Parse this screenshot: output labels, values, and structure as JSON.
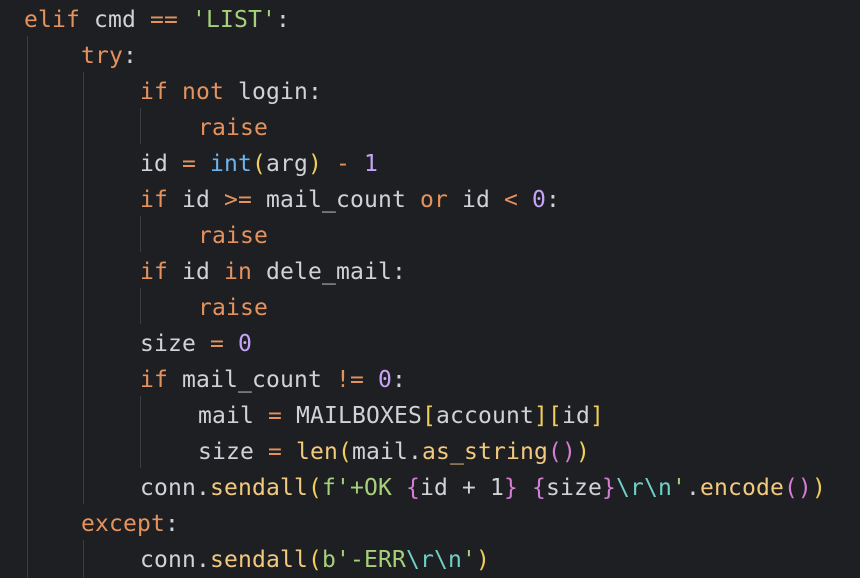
{
  "theme": {
    "background": "#1e1f22",
    "colors": {
      "keyword": "#e5925d",
      "string": "#a6d07a",
      "number": "#c6a3f7",
      "builtin": "#6cb4ee",
      "function": "#f2c97d",
      "plain": "#cfd2d6",
      "bracket": "#f0d05a",
      "escape": "#6fd0c6",
      "indent_guide": "#3a3d42"
    }
  },
  "code": {
    "lines": [
      [
        {
          "t": "elif",
          "c": "kw"
        },
        {
          "t": " cmd ",
          "c": "pl"
        },
        {
          "t": "==",
          "c": "op"
        },
        {
          "t": " ",
          "c": "pl"
        },
        {
          "t": "'LIST'",
          "c": "str"
        },
        {
          "t": ":",
          "c": "punc"
        }
      ],
      [
        {
          "t": "try",
          "c": "kw"
        },
        {
          "t": ":",
          "c": "punc"
        }
      ],
      [
        {
          "t": "if",
          "c": "kw"
        },
        {
          "t": " ",
          "c": "pl"
        },
        {
          "t": "not",
          "c": "kw"
        },
        {
          "t": " login:",
          "c": "pl"
        }
      ],
      [
        {
          "t": "raise",
          "c": "kw"
        }
      ],
      [
        {
          "t": "id ",
          "c": "pl"
        },
        {
          "t": "=",
          "c": "op"
        },
        {
          "t": " ",
          "c": "pl"
        },
        {
          "t": "int",
          "c": "bi"
        },
        {
          "t": "(",
          "c": "paren"
        },
        {
          "t": "arg",
          "c": "pl"
        },
        {
          "t": ")",
          "c": "paren"
        },
        {
          "t": " ",
          "c": "pl"
        },
        {
          "t": "-",
          "c": "op"
        },
        {
          "t": " ",
          "c": "pl"
        },
        {
          "t": "1",
          "c": "num"
        }
      ],
      [
        {
          "t": "if",
          "c": "kw"
        },
        {
          "t": " id ",
          "c": "pl"
        },
        {
          "t": ">=",
          "c": "op"
        },
        {
          "t": " mail_count ",
          "c": "pl"
        },
        {
          "t": "or",
          "c": "kw"
        },
        {
          "t": " id ",
          "c": "pl"
        },
        {
          "t": "<",
          "c": "op"
        },
        {
          "t": " ",
          "c": "pl"
        },
        {
          "t": "0",
          "c": "num"
        },
        {
          "t": ":",
          "c": "punc"
        }
      ],
      [
        {
          "t": "raise",
          "c": "kw"
        }
      ],
      [
        {
          "t": "if",
          "c": "kw"
        },
        {
          "t": " id ",
          "c": "pl"
        },
        {
          "t": "in",
          "c": "kw"
        },
        {
          "t": " dele_mail:",
          "c": "pl"
        }
      ],
      [
        {
          "t": "raise",
          "c": "kw"
        }
      ],
      [
        {
          "t": "size ",
          "c": "pl"
        },
        {
          "t": "=",
          "c": "op"
        },
        {
          "t": " ",
          "c": "pl"
        },
        {
          "t": "0",
          "c": "num"
        }
      ],
      [
        {
          "t": "if",
          "c": "kw"
        },
        {
          "t": " mail_count ",
          "c": "pl"
        },
        {
          "t": "!=",
          "c": "op"
        },
        {
          "t": " ",
          "c": "pl"
        },
        {
          "t": "0",
          "c": "num"
        },
        {
          "t": ":",
          "c": "punc"
        }
      ],
      [
        {
          "t": "mail ",
          "c": "pl"
        },
        {
          "t": "=",
          "c": "op"
        },
        {
          "t": " MAILBOXES",
          "c": "pl"
        },
        {
          "t": "[",
          "c": "paren"
        },
        {
          "t": "account",
          "c": "pl"
        },
        {
          "t": "]",
          "c": "paren"
        },
        {
          "t": "[",
          "c": "paren"
        },
        {
          "t": "id",
          "c": "pl"
        },
        {
          "t": "]",
          "c": "paren"
        }
      ],
      [
        {
          "t": "size ",
          "c": "pl"
        },
        {
          "t": "=",
          "c": "op"
        },
        {
          "t": " ",
          "c": "pl"
        },
        {
          "t": "len",
          "c": "fn"
        },
        {
          "t": "(",
          "c": "paren"
        },
        {
          "t": "mail.",
          "c": "pl"
        },
        {
          "t": "as_string",
          "c": "fn"
        },
        {
          "t": "()",
          "c": "paren2"
        },
        {
          "t": ")",
          "c": "paren"
        }
      ],
      [
        {
          "t": "conn.",
          "c": "pl"
        },
        {
          "t": "sendall",
          "c": "fn"
        },
        {
          "t": "(",
          "c": "paren"
        },
        {
          "t": "f'+OK ",
          "c": "str"
        },
        {
          "t": "{",
          "c": "paren2"
        },
        {
          "t": "id + 1",
          "c": "pl"
        },
        {
          "t": "}",
          "c": "paren2"
        },
        {
          "t": " ",
          "c": "str"
        },
        {
          "t": "{",
          "c": "paren2"
        },
        {
          "t": "size",
          "c": "pl"
        },
        {
          "t": "}",
          "c": "paren2"
        },
        {
          "t": "\\r\\n",
          "c": "esc"
        },
        {
          "t": "'",
          "c": "str"
        },
        {
          "t": ".",
          "c": "pl"
        },
        {
          "t": "encode",
          "c": "fn"
        },
        {
          "t": "()",
          "c": "paren2"
        },
        {
          "t": ")",
          "c": "paren"
        }
      ],
      [
        {
          "t": "except",
          "c": "kw"
        },
        {
          "t": ":",
          "c": "punc"
        }
      ],
      [
        {
          "t": "conn.",
          "c": "pl"
        },
        {
          "t": "sendall",
          "c": "fn"
        },
        {
          "t": "(",
          "c": "paren"
        },
        {
          "t": "b'-ERR",
          "c": "str"
        },
        {
          "t": "\\r\\n",
          "c": "esc"
        },
        {
          "t": "'",
          "c": "str"
        },
        {
          "t": ")",
          "c": "paren"
        }
      ]
    ]
  }
}
